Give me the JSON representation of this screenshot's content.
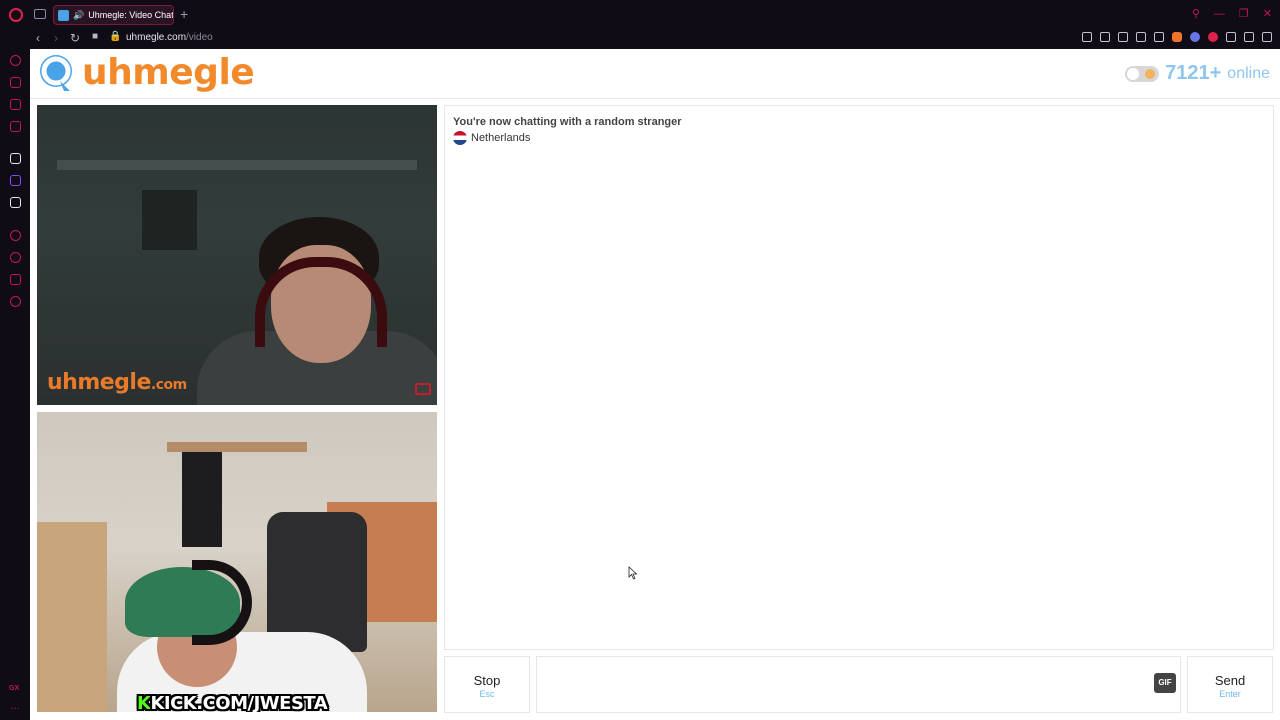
{
  "browser": {
    "tab_title": "Uhmegle: Video Chat",
    "url_host": "uhmegle.com",
    "url_path": "/video",
    "new_tab_symbol": "+",
    "icons": [
      "opera-logo-icon",
      "tab-switcher-icon",
      "speaker-icon",
      "back-icon",
      "forward-icon",
      "reload-icon",
      "camera-icon",
      "lock-icon"
    ]
  },
  "header": {
    "logo_text": "uhmegle",
    "online_count": "7121+",
    "online_label": "online"
  },
  "videos": {
    "stranger_watermark": "uhmegle",
    "stranger_watermark_suffix": ".com",
    "self_overlay_k": "K",
    "self_overlay_text": "KICK.COM/JWESTA"
  },
  "chat": {
    "status": "You're now chatting with a random stranger",
    "country": "Netherlands"
  },
  "controls": {
    "stop_label": "Stop",
    "stop_hint": "Esc",
    "gif_label": "GIF",
    "send_label": "Send",
    "send_hint": "Enter",
    "message_value": ""
  },
  "colors": {
    "brand_orange": "#f28a2c",
    "online_blue": "#8ec6ef",
    "opera_red": "#e0224b"
  }
}
